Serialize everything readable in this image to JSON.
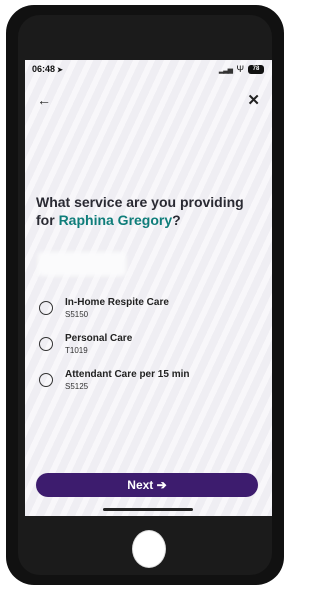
{
  "status": {
    "time": "06:48",
    "location_icon": "➤",
    "signal_icon": "▂▃▅",
    "wifi_icon": "Ψ",
    "battery_level": "78"
  },
  "nav": {
    "back_icon": "←",
    "close_icon": "✕"
  },
  "question": {
    "prefix": "What service are you providing for ",
    "name": "Raphina Gregory",
    "suffix": "?"
  },
  "options": [
    {
      "title": "In-Home Respite Care",
      "code": "S5150"
    },
    {
      "title": "Personal Care",
      "code": "T1019"
    },
    {
      "title": "Attendant Care per 15 min",
      "code": "S5125"
    }
  ],
  "next_button": {
    "label": "Next ➔"
  },
  "colors": {
    "accent": "#0f7d7a",
    "primary_button": "#3d1c6e"
  }
}
